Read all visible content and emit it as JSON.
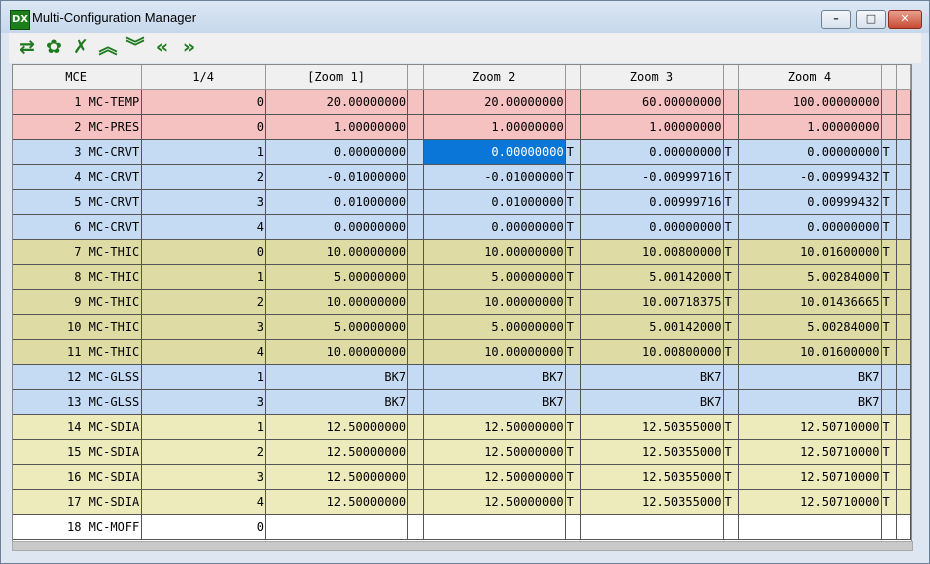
{
  "window": {
    "title": "Multi-Configuration Manager",
    "icon_text": "DX"
  },
  "controls": {
    "minimize": "–",
    "maximize": "□",
    "close": "✕"
  },
  "toolbar": [
    {
      "name": "refresh-icon",
      "glyph": "⇄"
    },
    {
      "name": "settings-gear-icon",
      "glyph": "✿"
    },
    {
      "name": "delete-x-icon",
      "glyph": "✗"
    },
    {
      "name": "double-chevron-up-icon",
      "glyph": "︽"
    },
    {
      "name": "double-chevron-down-icon",
      "glyph": "︾"
    },
    {
      "name": "double-chevron-left-icon",
      "glyph": "«"
    },
    {
      "name": "double-chevron-right-icon",
      "glyph": "»"
    }
  ],
  "headers": [
    "MCE",
    "1/4",
    "[Zoom 1]",
    "Zoom 2",
    "Zoom 3",
    "Zoom 4"
  ],
  "rows": [
    {
      "label": "1 MC-TEMP",
      "group": "temp",
      "config": "0",
      "values": [
        "20.00000000",
        "20.00000000",
        "60.00000000",
        "100.00000000"
      ],
      "solves": [
        "",
        "",
        "",
        ""
      ]
    },
    {
      "label": "2 MC-PRES",
      "group": "temp",
      "config": "0",
      "values": [
        "1.00000000",
        "1.00000000",
        "1.00000000",
        "1.00000000"
      ],
      "solves": [
        "",
        "",
        "",
        ""
      ]
    },
    {
      "label": "3 MC-CRVT",
      "group": "crvt",
      "config": "1",
      "values": [
        "0.00000000",
        "0.00000000",
        "0.00000000",
        "0.00000000"
      ],
      "solves": [
        "",
        "T",
        "T",
        "T"
      ],
      "selected_col": 1
    },
    {
      "label": "4 MC-CRVT",
      "group": "crvt",
      "config": "2",
      "values": [
        "-0.01000000",
        "-0.01000000",
        "-0.00999716",
        "-0.00999432"
      ],
      "solves": [
        "",
        "T",
        "T",
        "T"
      ]
    },
    {
      "label": "5 MC-CRVT",
      "group": "crvt",
      "config": "3",
      "values": [
        "0.01000000",
        "0.01000000",
        "0.00999716",
        "0.00999432"
      ],
      "solves": [
        "",
        "T",
        "T",
        "T"
      ]
    },
    {
      "label": "6 MC-CRVT",
      "group": "crvt",
      "config": "4",
      "values": [
        "0.00000000",
        "0.00000000",
        "0.00000000",
        "0.00000000"
      ],
      "solves": [
        "",
        "T",
        "T",
        "T"
      ]
    },
    {
      "label": "7 MC-THIC",
      "group": "thic",
      "config": "0",
      "values": [
        "10.00000000",
        "10.00000000",
        "10.00800000",
        "10.01600000"
      ],
      "solves": [
        "",
        "T",
        "T",
        "T"
      ]
    },
    {
      "label": "8 MC-THIC",
      "group": "thic",
      "config": "1",
      "values": [
        "5.00000000",
        "5.00000000",
        "5.00142000",
        "5.00284000"
      ],
      "solves": [
        "",
        "T",
        "T",
        "T"
      ]
    },
    {
      "label": "9 MC-THIC",
      "group": "thic",
      "config": "2",
      "values": [
        "10.00000000",
        "10.00000000",
        "10.00718375",
        "10.01436665"
      ],
      "solves": [
        "",
        "T",
        "T",
        "T"
      ]
    },
    {
      "label": "10 MC-THIC",
      "group": "thic",
      "config": "3",
      "values": [
        "5.00000000",
        "5.00000000",
        "5.00142000",
        "5.00284000"
      ],
      "solves": [
        "",
        "T",
        "T",
        "T"
      ]
    },
    {
      "label": "11 MC-THIC",
      "group": "thic",
      "config": "4",
      "values": [
        "10.00000000",
        "10.00000000",
        "10.00800000",
        "10.01600000"
      ],
      "solves": [
        "",
        "T",
        "T",
        "T"
      ]
    },
    {
      "label": "12 MC-GLSS",
      "group": "glss",
      "config": "1",
      "values": [
        "BK7",
        "BK7",
        "BK7",
        "BK7"
      ],
      "solves": [
        "",
        "",
        "",
        ""
      ]
    },
    {
      "label": "13 MC-GLSS",
      "group": "glss",
      "config": "3",
      "values": [
        "BK7",
        "BK7",
        "BK7",
        "BK7"
      ],
      "solves": [
        "",
        "",
        "",
        ""
      ]
    },
    {
      "label": "14 MC-SDIA",
      "group": "sdia",
      "config": "1",
      "values": [
        "12.50000000",
        "12.50000000",
        "12.50355000",
        "12.50710000"
      ],
      "solves": [
        "",
        "T",
        "T",
        "T"
      ]
    },
    {
      "label": "15 MC-SDIA",
      "group": "sdia",
      "config": "2",
      "values": [
        "12.50000000",
        "12.50000000",
        "12.50355000",
        "12.50710000"
      ],
      "solves": [
        "",
        "T",
        "T",
        "T"
      ]
    },
    {
      "label": "16 MC-SDIA",
      "group": "sdia",
      "config": "3",
      "values": [
        "12.50000000",
        "12.50000000",
        "12.50355000",
        "12.50710000"
      ],
      "solves": [
        "",
        "T",
        "T",
        "T"
      ]
    },
    {
      "label": "17 MC-SDIA",
      "group": "sdia",
      "config": "4",
      "values": [
        "12.50000000",
        "12.50000000",
        "12.50355000",
        "12.50710000"
      ],
      "solves": [
        "",
        "T",
        "T",
        "T"
      ]
    },
    {
      "label": "18 MC-MOFF",
      "group": "moff",
      "config": "0",
      "values": [
        "",
        "",
        "",
        ""
      ],
      "solves": [
        "",
        "",
        "",
        ""
      ]
    }
  ],
  "colors": {
    "temp": "#f6c1c1",
    "crvt": "#c4dbf3",
    "thic": "#dedca4",
    "glss": "#c4dbf3",
    "sdia": "#edebbb",
    "moff": "#ffffff",
    "selection": "#0a76d8"
  }
}
